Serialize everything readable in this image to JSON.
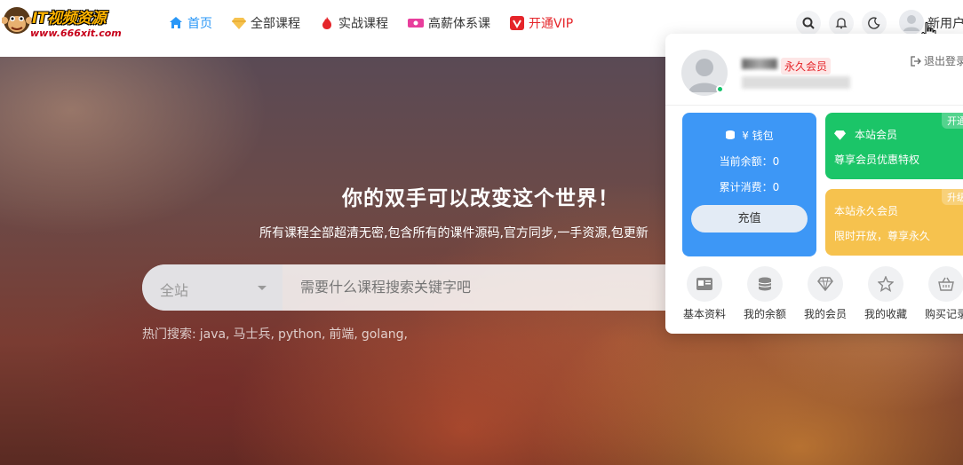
{
  "logo": {
    "title": "IT视频资源",
    "url": "www.666xit.com"
  },
  "nav": [
    {
      "label": "首页",
      "icon": "home-icon"
    },
    {
      "label": "全部课程",
      "icon": "diamond-icon"
    },
    {
      "label": "实战课程",
      "icon": "fire-icon"
    },
    {
      "label": "高薪体系课",
      "icon": "ticket-icon"
    },
    {
      "label": "开通VIP",
      "icon": "vip-icon"
    }
  ],
  "header": {
    "username": "新用户"
  },
  "hero": {
    "title": "你的双手可以改变这个世界！",
    "subtitle": "所有课程全部超清无密,包含所有的课件源码,官方同步,一手资源,包更新",
    "search_scope": "全站",
    "search_placeholder": "需要什么课程搜索关键字吧",
    "hot_label": "热门搜索:",
    "hot_terms": [
      "java,",
      "马士兵,",
      "python,",
      "前端,",
      "golang,"
    ]
  },
  "panel": {
    "badge": "永久会员",
    "logout": "退出登录",
    "wallet": {
      "title": "¥ 钱包",
      "balance": "当前余额：0",
      "spent": "累计消费：0",
      "recharge": "充值"
    },
    "vip_cards": [
      {
        "title": "本站会员",
        "desc": "尊享会员优惠特权",
        "tag": "开通"
      },
      {
        "title": "本站永久会员",
        "desc": "限时开放，尊享永久",
        "tag": "升级"
      }
    ],
    "shortcuts": [
      {
        "label": "基本资料",
        "icon": "id-card-icon"
      },
      {
        "label": "我的余额",
        "icon": "coins-icon"
      },
      {
        "label": "我的会员",
        "icon": "diamond-icon"
      },
      {
        "label": "我的收藏",
        "icon": "star-icon"
      },
      {
        "label": "购买记录",
        "icon": "basket-icon"
      }
    ]
  },
  "colors": {
    "accent": "#2997f7",
    "vip": "#e5252a",
    "wallet": "#3d97f6",
    "green": "#1bc568",
    "yellow": "#f6c24e"
  }
}
